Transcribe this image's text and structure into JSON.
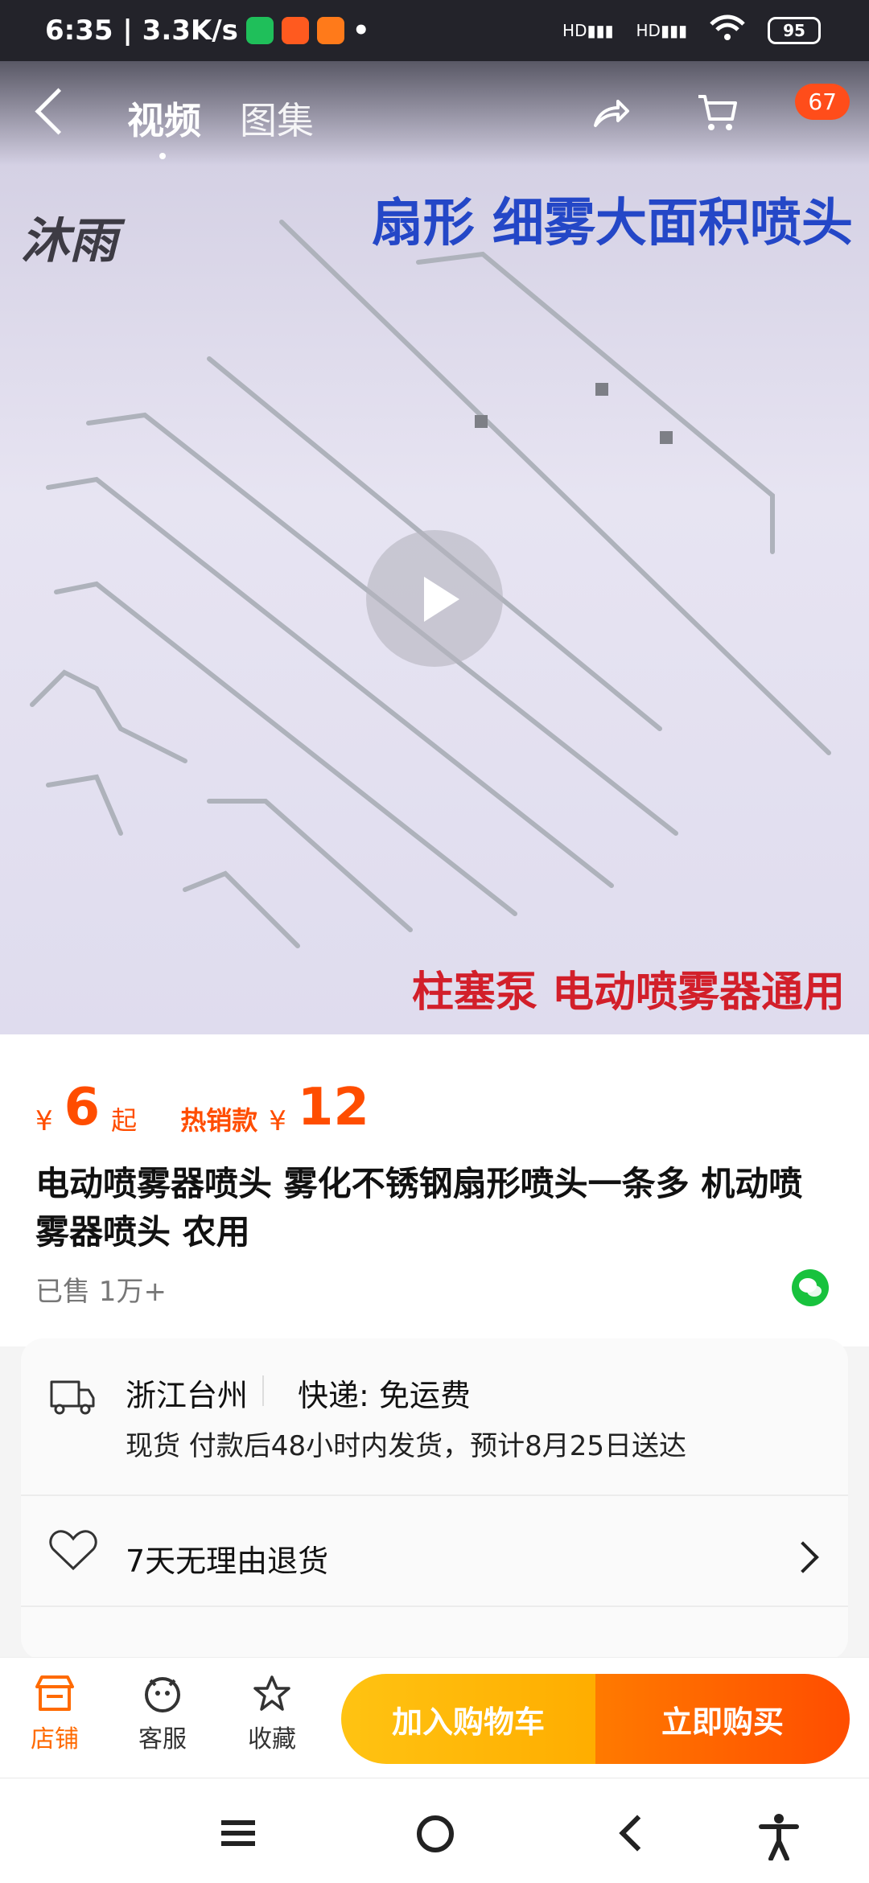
{
  "status": {
    "time_speed": "6:35 | 3.3K/s",
    "battery": "95",
    "network1": "HD",
    "network2": "HD"
  },
  "topbar": {
    "tab_video": "视频",
    "tab_gallery": "图集",
    "cart_badge": "67"
  },
  "media": {
    "logo_text": "沐雨",
    "headline": "扇形  细雾大面积喷头",
    "bottomline": "柱塞泵  电动喷雾器通用"
  },
  "product": {
    "yen1": "¥",
    "price_from": "6",
    "qi": "起",
    "hot_label": "热销款",
    "yen2": "¥",
    "hot_price": "12",
    "title": "电动喷雾器喷头 雾化不锈钢扇形喷头一条多 机动喷雾器喷头 农用",
    "sold": "已售 1万+"
  },
  "service": {
    "location": "浙江台州",
    "express": "快递:  免运费",
    "stock_info": "现货 付款后48小时内发货，预计8月25日送达",
    "return_policy": "7天无理由退货"
  },
  "actions": {
    "shop": "店铺",
    "service": "客服",
    "favorite": "收藏",
    "add_cart": "加入购物车",
    "buy_now": "立即购买"
  },
  "colors": {
    "accent": "#ff4d00",
    "cart_button": "#ffb400",
    "wechat": "#18c23d"
  }
}
